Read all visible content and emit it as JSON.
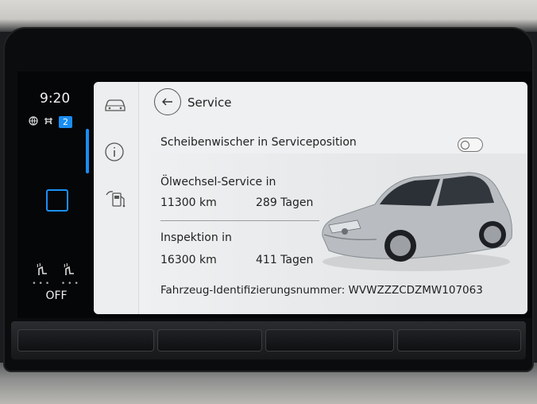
{
  "status": {
    "time": "9:20",
    "badge_count": "2",
    "seat_heat": "OFF"
  },
  "header": {
    "title": "Service",
    "back_icon": "back-arrow-icon"
  },
  "side_nav": [
    {
      "icon": "car-icon"
    },
    {
      "icon": "info-icon"
    },
    {
      "icon": "fuel-pump-icon"
    }
  ],
  "wiper": {
    "label": "Scheibenwischer in Serviceposition",
    "toggle_on": false
  },
  "oil_service": {
    "label": "Ölwechsel-Service in",
    "km": "11300 km",
    "days": "289 Tagen"
  },
  "inspection": {
    "label": "Inspektion in",
    "km": "16300 km",
    "days": "411 Tagen"
  },
  "vin": {
    "label": "Fahrzeug-Identifizierungsnummer: WVWZZZCDZMW107063"
  },
  "colors": {
    "accent": "#1a8df0",
    "panel_bg": "#eef0f1"
  }
}
